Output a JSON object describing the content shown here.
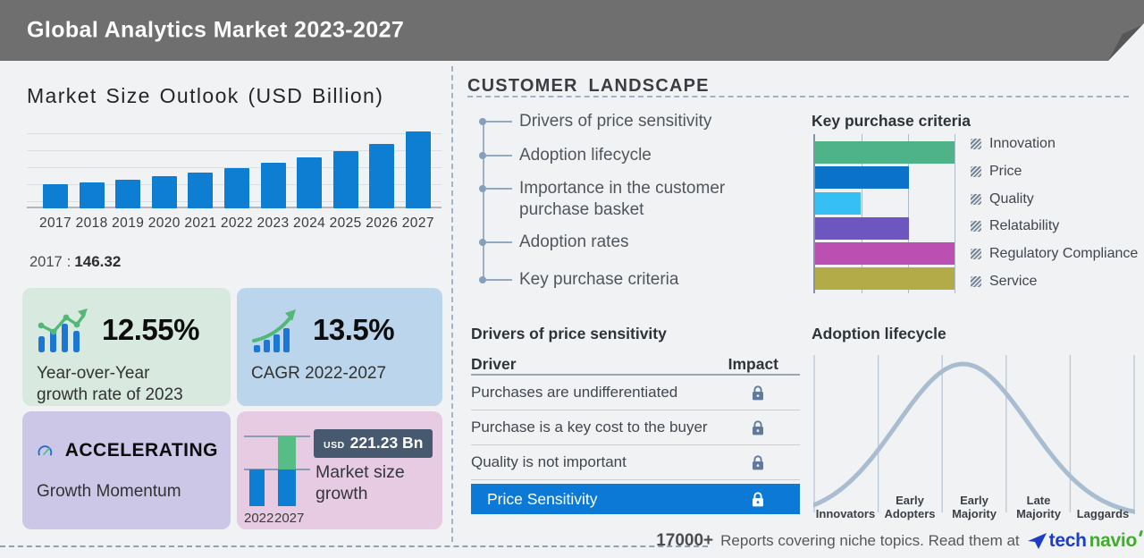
{
  "header": {
    "title": "Global Analytics Market 2023-2027"
  },
  "left": {
    "chart_title": "Market Size Outlook (USD Billion)",
    "base_year_label": "2017",
    "base_separator": ":",
    "base_year_value": "146.32",
    "stats": [
      {
        "icon": "bar-trend-icon",
        "value": "12.55%",
        "label": "Year-over-Year growth rate of 2023",
        "bg": "#d8e9df"
      },
      {
        "icon": "growth-arrow-icon",
        "value": "13.5%",
        "label": "CAGR 2022-2027",
        "bg": "#bbd6ec"
      },
      {
        "icon": "speedometer-icon",
        "value": "ACCELERATING",
        "label": "Growth Momentum",
        "bg": "#ccc7e7"
      },
      {
        "icon": "mini-bar-chart",
        "label": "Market size growth",
        "bg": "#e7cbe2"
      }
    ]
  },
  "middle": {
    "section_title": "CUSTOMER LANDSCAPE",
    "landscape_items": [
      "Drivers of price sensitivity",
      "Adoption lifecycle",
      "Importance in the customer purchase basket",
      "Adoption rates",
      "Key purchase criteria"
    ],
    "drivers": {
      "title": "Drivers of price sensitivity",
      "col_driver": "Driver",
      "col_impact": "Impact",
      "rows": [
        "Purchases are undifferentiated",
        "Purchase is a key cost to the buyer",
        "Quality is not important"
      ],
      "highlight_row": "Price Sensitivity"
    }
  },
  "right": {
    "kpc_title": "Key purchase criteria",
    "lifecycle_title": "Adoption lifecycle"
  },
  "footer": {
    "count": "17000+",
    "text": "Reports covering niche topics. Read them at",
    "logo_part1": "tech",
    "logo_part2": "navio"
  },
  "colors": {
    "header_bg": "#6f6f6f",
    "page_bg": "#f1f2f4",
    "bar_blue": "#0d7ed2",
    "icon_blue": "#1c77d4",
    "icon_green": "#53b877",
    "badge_bg": "#47596e",
    "highlight_row_blue": "#0c79d6",
    "lock": "#5f7a9d",
    "curve": "#a9bdd1",
    "logo_blue": "#1c3ec6",
    "logo_green": "#3fae2a"
  },
  "chart_data": [
    {
      "id": "market_size_outlook",
      "type": "bar",
      "title": "Market Size Outlook (USD Billion)",
      "categories": [
        "2017",
        "2018",
        "2019",
        "2020",
        "2021",
        "2022",
        "2023",
        "2024",
        "2025",
        "2026",
        "2027"
      ],
      "values": [
        146.32,
        161,
        178,
        198,
        221,
        248,
        278,
        312,
        350,
        393,
        470
      ],
      "labeled_point": {
        "category": "2017",
        "value": 146.32
      },
      "ylim": [
        0,
        500
      ],
      "grid": true,
      "bar_color": "#0d7ed2"
    },
    {
      "id": "key_purchase_criteria",
      "type": "bar",
      "orientation": "horizontal",
      "title": "Key purchase criteria",
      "categories": [
        "Innovation",
        "Price",
        "Quality",
        "Relatability",
        "Regulatory Compliance",
        "Service"
      ],
      "values": [
        100,
        67,
        33,
        67,
        100,
        100
      ],
      "xlim": [
        0,
        100
      ],
      "colors": [
        "#4fb38a",
        "#0b72ca",
        "#35bff2",
        "#6d56bf",
        "#bc50b2",
        "#b3ab47"
      ],
      "legend_position": "right",
      "grid": true
    },
    {
      "id": "adoption_lifecycle",
      "type": "line",
      "curve": "bell",
      "title": "Adoption lifecycle",
      "categories": [
        "Innovators",
        "Early Adopters",
        "Early Majority",
        "Late Majority",
        "Laggards"
      ],
      "peak_fraction": 0.465,
      "sigma_fraction": 0.205,
      "line_color": "#a9bdd1",
      "grid": true
    },
    {
      "id": "market_size_growth",
      "type": "bar",
      "title": "Market size growth",
      "categories": [
        "2022",
        "2027"
      ],
      "values": [
        249,
        470
      ],
      "increment_currency": "USD",
      "increment_value": "221.23 Bn",
      "base_color": "#0d7ed2",
      "increment_color": "#57bd86"
    }
  ]
}
